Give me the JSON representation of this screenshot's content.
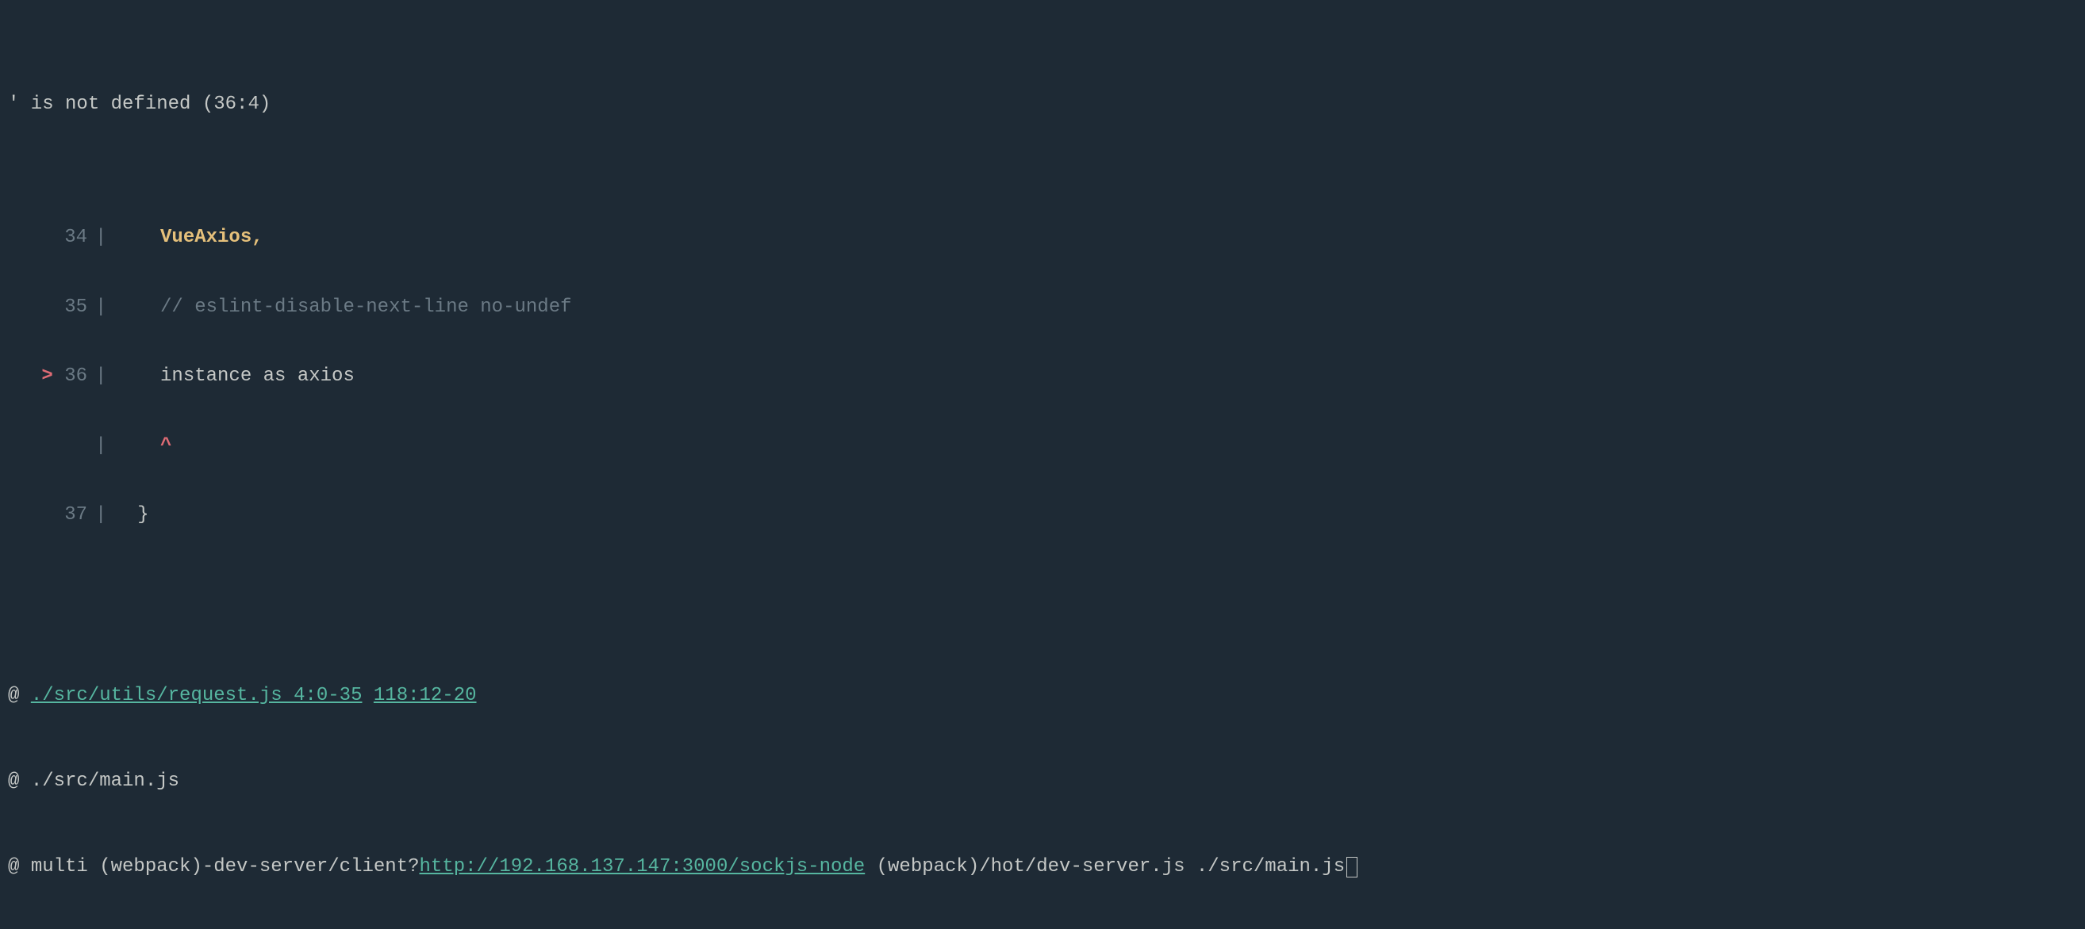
{
  "error": {
    "title": "' is not defined (36:4)"
  },
  "code": {
    "lines": [
      {
        "number": "34",
        "arrow": "  ",
        "indent": "    ",
        "content": "VueAxios,",
        "type": "highlight"
      },
      {
        "number": "35",
        "arrow": "  ",
        "indent": "    ",
        "content": "// eslint-disable-next-line no-undef",
        "type": "comment"
      },
      {
        "number": "36",
        "arrow": "> ",
        "indent": "    ",
        "content": "instance as axios",
        "type": "normal"
      },
      {
        "number": "",
        "arrow": "  ",
        "indent": "    ",
        "content": "^",
        "type": "caret"
      },
      {
        "number": "37",
        "arrow": "  ",
        "indent": "  ",
        "content": "}",
        "type": "normal"
      }
    ]
  },
  "trace": {
    "at_symbol": "@ ",
    "line1_link1": "./src/utils/request.js 4:0-35",
    "line1_link2": "118:12-20",
    "line2_path": "./src/main.js",
    "line3_prefix": "multi (webpack)-dev-server/client?",
    "line3_url": "http://192.168.137.147:3000/sockjs-node",
    "line3_suffix": " (webpack)/hot/dev-server.js ./src/main.js"
  }
}
